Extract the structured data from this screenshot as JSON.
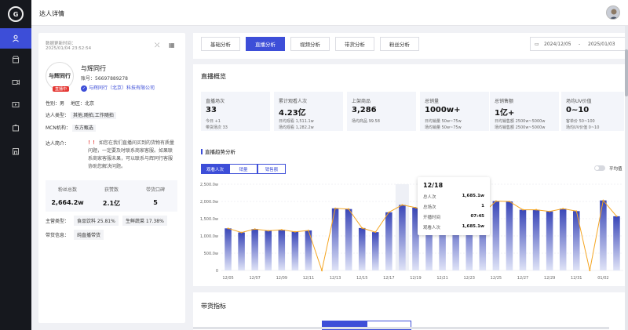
{
  "header": {
    "page_title": "达人详情"
  },
  "profile": {
    "update_label": "数据更新时间：",
    "update_time": "2025/01/04 23:52:54",
    "name": "与辉同行",
    "account": "账号：56697889278",
    "company": "与辉同行（北京）科技有限公司",
    "live_tag": "直播中",
    "avatar_text": "与辉同行",
    "gender_label": "性别：",
    "gender": "男",
    "region_label": "地区：",
    "region": "北京",
    "type_label": "达人类型：",
    "type": "其他,随拍,工作随拍",
    "mcn_label": "MCN机构：",
    "mcn": "东方甄选",
    "intro_label": "达人简介：",
    "intro_warn": "！！",
    "intro": "如您在我们直播间买到的货物有质量问题，一定要及时联系商家客服。如果联系商家客服未果，可以联系与辉同行客服协助您解决问题。",
    "stats": [
      {
        "label": "粉丝总数",
        "value": "2,664.2w"
      },
      {
        "label": "获赞数",
        "value": "2.1亿"
      },
      {
        "label": "带货口碑",
        "value": "5"
      }
    ],
    "category_label": "主营类型：",
    "categories": [
      "食品饮料 25.81%",
      "生鲜蔬菜 17.38%"
    ],
    "goods_label": "带货信息：",
    "goods_type": "纯直播带货"
  },
  "tabs": [
    "基础分析",
    "直播分析",
    "视频分析",
    "带货分析",
    "粉丝分析"
  ],
  "active_tab": 1,
  "date_range": {
    "start": "2024/12/05",
    "sep": "-",
    "end": "2025/01/03"
  },
  "overview": {
    "title": "直播概览",
    "cards": [
      {
        "label": "直播场次",
        "value": "33",
        "sub1": "今日 +1",
        "sub2": "带货场次 33"
      },
      {
        "label": "累计观看人次",
        "value": "4.23亿",
        "sub1": "日均观看 1,511.1w",
        "sub2": "场均观看 1,282.2w"
      },
      {
        "label": "上架商品",
        "value": "3,286",
        "sub1": "场均商品 99.58",
        "sub2": ""
      },
      {
        "label": "总销量",
        "value": "1000w+",
        "sub1": "日均销量 50w~75w",
        "sub2": "场均销量 50w~75w"
      },
      {
        "label": "总销售额",
        "value": "1亿+",
        "sub1": "日均销售额 2500w~5000w",
        "sub2": "场均销售额 2500w~5000w"
      },
      {
        "label": "场均UV价值",
        "value": "0~10",
        "sub1": "客单价 50~100",
        "sub2": "场均UV价值 0~10"
      }
    ]
  },
  "trend": {
    "title": "直播趋势分析",
    "tabs": [
      "观看人次",
      "销量",
      "销售额"
    ],
    "avg_label": "平均值"
  },
  "tooltip": {
    "date": "12/18",
    "rows": [
      {
        "label": "总人次",
        "value": "1,685.1w"
      },
      {
        "label": "总场次",
        "value": "1"
      },
      {
        "label": "开播时间",
        "value": "07:45"
      },
      {
        "label": "观看人次",
        "value": "1,685.1w"
      }
    ]
  },
  "goods": {
    "title": "带货指标"
  },
  "chart_data": {
    "type": "bar",
    "x": [
      "12/05",
      "12/06",
      "12/07",
      "12/08",
      "12/09",
      "12/10",
      "12/11",
      "12/12",
      "12/13",
      "12/14",
      "12/15",
      "12/16",
      "12/17",
      "12/18",
      "12/19",
      "12/20",
      "12/21",
      "12/22",
      "12/23",
      "12/24",
      "12/25",
      "12/26",
      "12/27",
      "12/28",
      "12/29",
      "12/30",
      "12/31",
      "01/01",
      "01/02",
      "01/03"
    ],
    "x_ticks": [
      "12/05",
      "12/07",
      "12/09",
      "12/11",
      "12/13",
      "12/15",
      "12/17",
      "12/19",
      "12/21",
      "12/23",
      "12/25",
      "12/27",
      "12/29",
      "12/31",
      "01/02"
    ],
    "series": [
      {
        "type": "bar",
        "values": [
          1220,
          1100,
          1200,
          1150,
          1180,
          1120,
          1160,
          0,
          1800,
          1780,
          1230,
          1110,
          1685,
          1900,
          1820,
          1670,
          1840,
          1660,
          1650,
          1650,
          2010,
          2000,
          1760,
          1760,
          1710,
          1790,
          1720,
          0,
          2030,
          1570
        ]
      },
      {
        "type": "line",
        "values": [
          1220,
          1100,
          1200,
          1150,
          1180,
          1120,
          1160,
          0,
          1800,
          1780,
          1230,
          1110,
          1685,
          1900,
          1820,
          1670,
          1840,
          1660,
          1650,
          1650,
          2010,
          2000,
          1760,
          1760,
          1710,
          1790,
          1720,
          0,
          2030,
          1570
        ]
      }
    ],
    "ylim": [
      0,
      2500
    ],
    "yticks": [
      "0",
      "500.0w",
      "1,000.0w",
      "1,500.0w",
      "2,000.0w",
      "2,500.0w"
    ]
  }
}
